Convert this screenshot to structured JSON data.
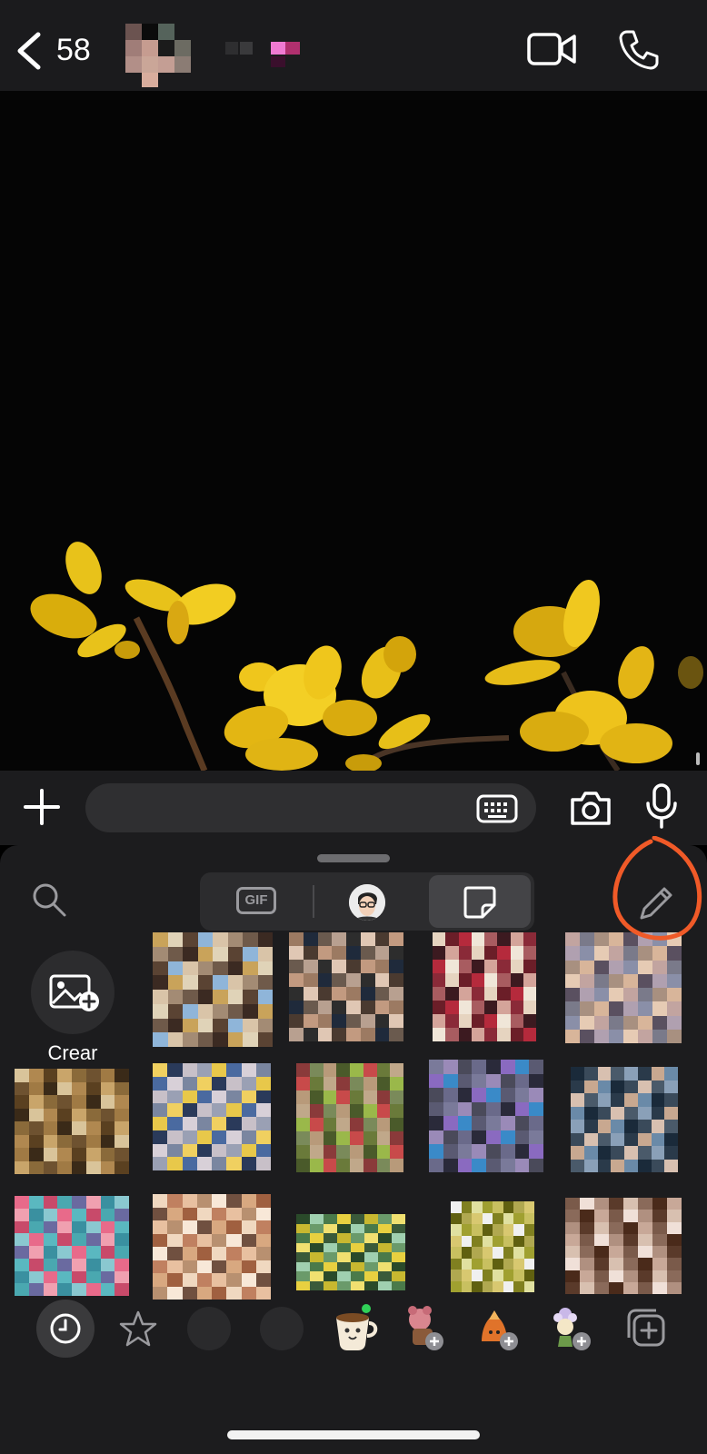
{
  "header": {
    "back_count": "58",
    "icons": {
      "back": "chevron-left-icon",
      "video": "video-camera-icon",
      "call": "phone-icon"
    }
  },
  "composer": {
    "message_value": "",
    "icons": {
      "plus": "plus-icon",
      "keyboard": "keyboard-icon",
      "camera": "camera-icon",
      "mic": "microphone-icon"
    }
  },
  "panel": {
    "gif_label": "GIF",
    "create_label": "Crear",
    "selected_tab": "stickers",
    "icons": {
      "search": "search-icon",
      "edit": "pencil-icon",
      "create": "add-image-icon"
    }
  },
  "tabs": {
    "items": [
      "recent",
      "favorites",
      "pack-blank-1",
      "pack-blank-2",
      "pack-cup",
      "pack-pink",
      "pack-orange",
      "pack-flower",
      "add-pack"
    ]
  },
  "colors": {
    "header_bg": "#1b1b1d",
    "panel_bg": "#1c1c1e",
    "annotation": "#f05a28",
    "new_dot": "#30d158",
    "flower_yellow": "#f1c40f"
  }
}
